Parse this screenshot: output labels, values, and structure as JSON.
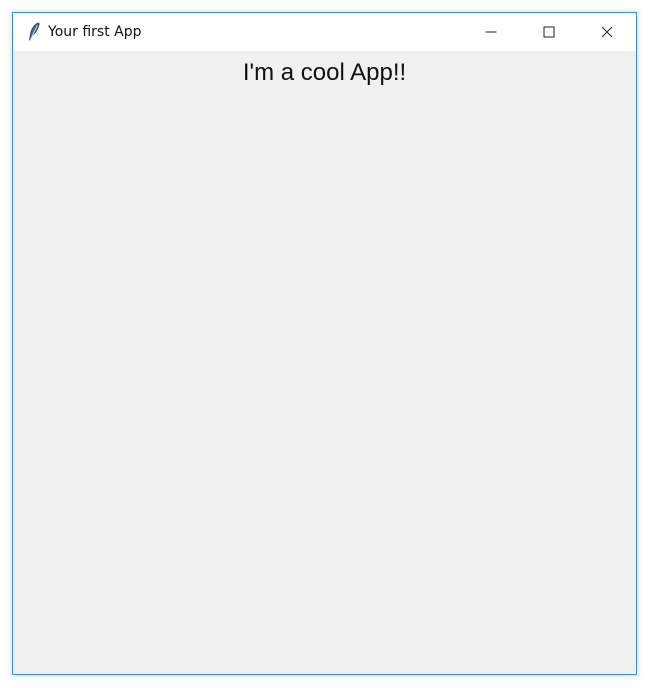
{
  "window": {
    "title": "Your first App"
  },
  "content": {
    "heading": "I'm a cool App!!"
  },
  "icons": {
    "app": "feather-icon",
    "minimize": "minimize-icon",
    "maximize": "maximize-icon",
    "close": "close-icon"
  },
  "colors": {
    "border": "#3c8fd6",
    "titlebar": "#ffffff",
    "background": "#f0f0f0",
    "text": "#111111"
  }
}
